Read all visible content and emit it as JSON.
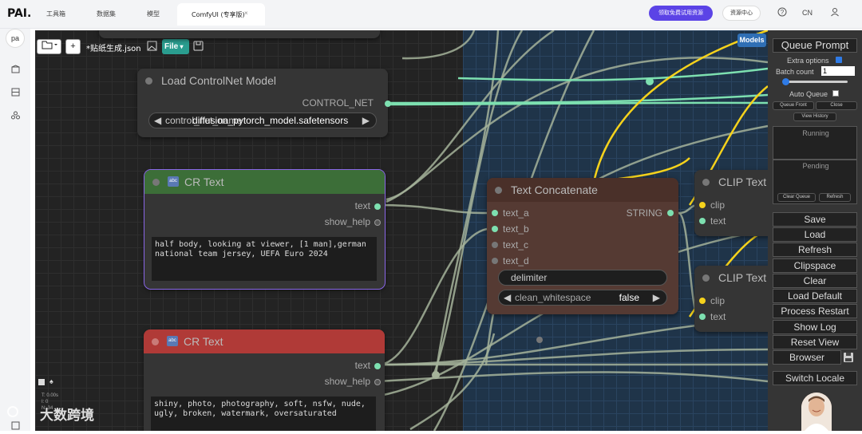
{
  "topbar": {
    "brand": "PAI.",
    "nav": [
      "工具箱",
      "数据集",
      "模型"
    ],
    "active_tab": "ComfyUI (专享版)",
    "tab_close": "×",
    "promo_button": "领取免费试用资源",
    "resource_center": "资源中心",
    "lang": "CN"
  },
  "leftnav": {
    "avatar": "pa"
  },
  "canvas_toolbar": {
    "add": "+",
    "filename": "*贴纸生成.json",
    "file_menu": "File"
  },
  "models_tab": "Models",
  "nodes": {
    "controlnet": {
      "title": "Load ControlNet Model",
      "output": "CONTROL_NET",
      "combo_label": "control_net_name",
      "combo_value": "diffusion_pytorch_model.safetensors"
    },
    "cr_text_1": {
      "title": "CR Text",
      "out_text": "text",
      "out_help": "show_help",
      "text": "half body, looking at viewer, [1 man],german national team jersey, UEFA Euro 2024"
    },
    "cr_text_2": {
      "title": "CR Text",
      "out_text": "text",
      "out_help": "show_help",
      "text": "shiny, photo, photography, soft, nsfw, nude, ugly, broken, watermark, oversaturated"
    },
    "concat": {
      "title": "Text Concatenate",
      "inputs": [
        "text_a",
        "text_b",
        "text_c",
        "text_d"
      ],
      "output": "STRING",
      "delimiter": "delimiter",
      "clean_label": "clean_whitespace",
      "clean_value": "false"
    },
    "clip1": {
      "title": "CLIP Text",
      "in_clip": "clip",
      "in_text": "text"
    },
    "clip2": {
      "title": "CLIP Text",
      "in_clip": "clip",
      "in_text": "text"
    }
  },
  "menu": {
    "queue_prompt": "Queue Prompt",
    "extra_options": "Extra options",
    "batch_count_label": "Batch count",
    "batch_count_value": "1",
    "auto_queue": "Auto Queue",
    "queue_front": "Queue Front",
    "close": "Close",
    "view_history": "View History",
    "running": "Running",
    "pending": "Pending",
    "clear_queue": "Clear Queue",
    "refresh_small": "Refresh",
    "buttons": [
      "Save",
      "Load",
      "Refresh",
      "Clipspace",
      "Clear",
      "Load Default",
      "Process Restart",
      "Show Log",
      "Reset View",
      "Browser"
    ],
    "switch_locale": "Switch Locale"
  },
  "canvas_info": {
    "t": "T: 0.00s",
    "i": "I: 0",
    "n": "N: 34"
  },
  "watermark": "大数跨境",
  "colors": {
    "green_node": "#3c6e38",
    "red_node": "#b03a37",
    "brown_node": "#553a33",
    "wire_green": "#7de0b0",
    "wire_yellow": "#f5d21c",
    "accent": "#5b43e6"
  }
}
